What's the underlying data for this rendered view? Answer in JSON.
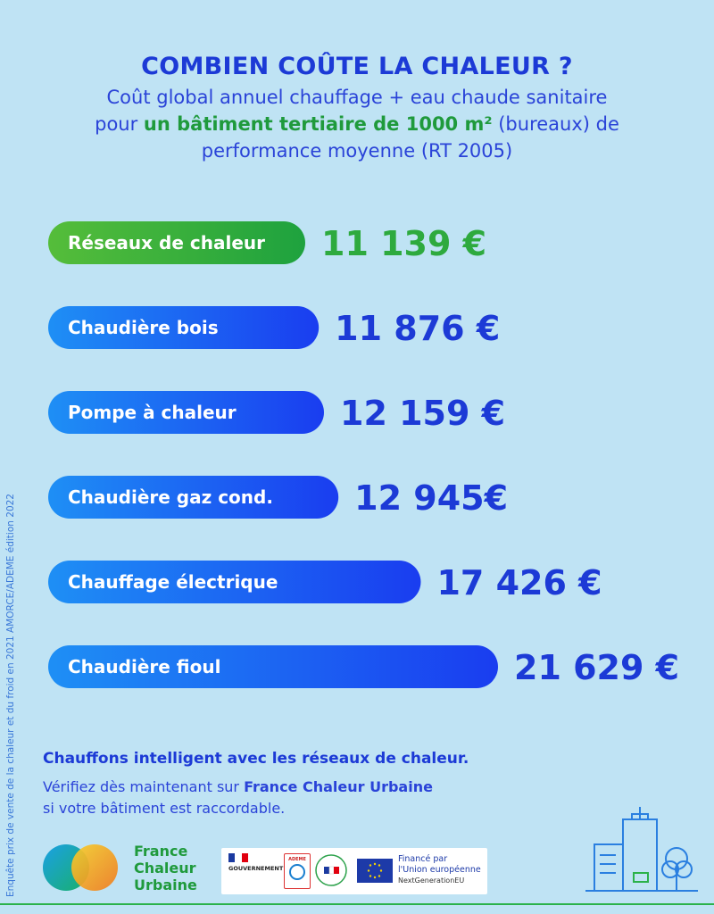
{
  "header": {
    "title": "COMBIEN COÛTE LA CHALEUR ?",
    "subtitle_line1": "Coût global annuel chauffage + eau chaude sanitaire",
    "subtitle_line2_pre": "pour ",
    "subtitle_line2_bold": "un bâtiment tertiaire de 1000 m²",
    "subtitle_line2_post": " (bureaux) de",
    "subtitle_line3": "performance moyenne (RT 2005)"
  },
  "chart_data": {
    "type": "bar",
    "orientation": "horizontal",
    "title": "COMBIEN COÛTE LA CHALEUR ?",
    "categories": [
      "Réseaux de chaleur",
      "Chaudière bois",
      "Pompe à chaleur",
      "Chaudière gaz cond.",
      "Chauffage électrique",
      "Chaudière fioul"
    ],
    "values": [
      11139,
      11876,
      12159,
      12945,
      17426,
      21629
    ],
    "value_labels": [
      "11 139 €",
      "11 876 €",
      "12 159 €",
      "12 945€",
      "17 426 €",
      "21 629 €"
    ],
    "unit": "€",
    "highlight_index": 0,
    "highlight_color": "#2eaa3e",
    "bar_color": "#1d57f0"
  },
  "cta": {
    "title": "Chauffons intelligent avec les réseaux de chaleur.",
    "line1_pre": "Vérifiez dès maintenant sur ",
    "line1_bold": "France Chaleur Urbaine",
    "line2": "si votre bâtiment est  raccordable."
  },
  "source": "Enquête prix de vente de la chaleur et du froid en 2021 AMORCE/ADEME édition 2022",
  "brand": {
    "line1": "France",
    "line2": "Chaleur",
    "line3": "Urbaine"
  },
  "partners": {
    "gov": "GOUVERNEMENT",
    "ademe": "ADEME",
    "france_relance": "FRANCE RELANCE",
    "eu_line1": "Financé par",
    "eu_line2": "l'Union européenne",
    "eu_line3": "NextGenerationEU"
  },
  "colors": {
    "background": "#bfe3f4",
    "title": "#1c3ad6",
    "green": "#1f9a3c"
  }
}
